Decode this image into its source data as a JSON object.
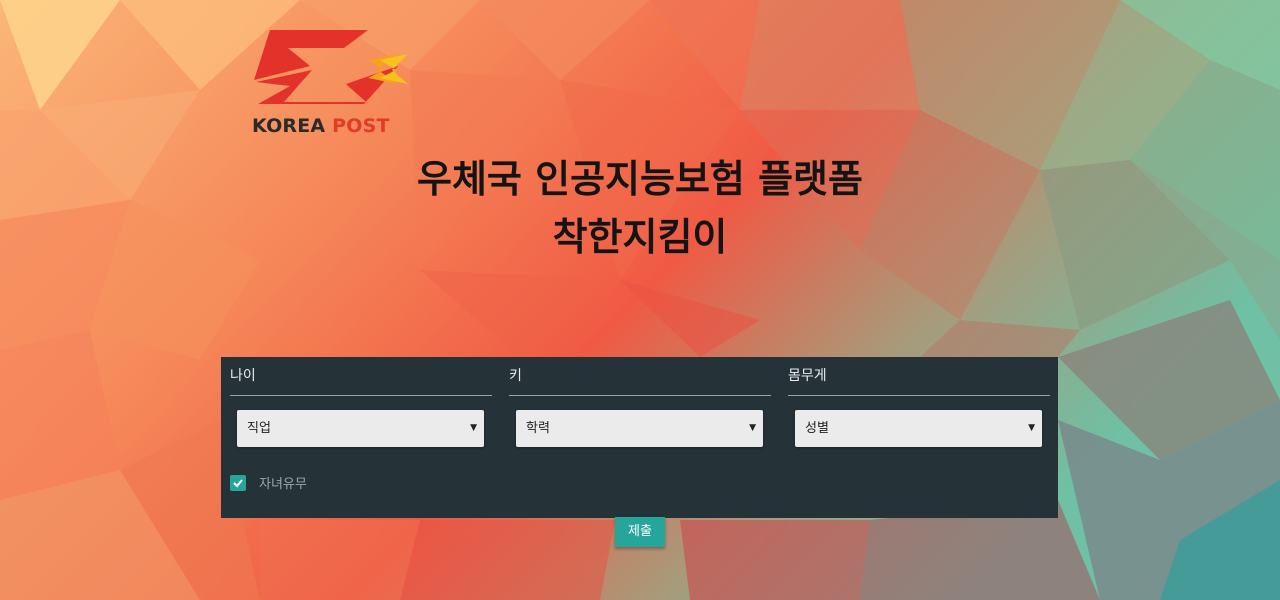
{
  "logo": {
    "brand_left": "KOREA",
    "brand_right": "POST"
  },
  "title": {
    "line1": "우체국 인공지능보험 플랫폼",
    "line2": "착한지킴이"
  },
  "form": {
    "fields": {
      "age_label": "나이",
      "height_label": "키",
      "weight_label": "몸무게"
    },
    "selects": {
      "job": "직업",
      "education": "학력",
      "gender": "성별"
    },
    "children": {
      "label": "자녀유무",
      "checked": true
    },
    "submit_label": "제출"
  },
  "colors": {
    "accent": "#26a69a",
    "panel": "#253238",
    "brand_red": "#e23b27"
  }
}
